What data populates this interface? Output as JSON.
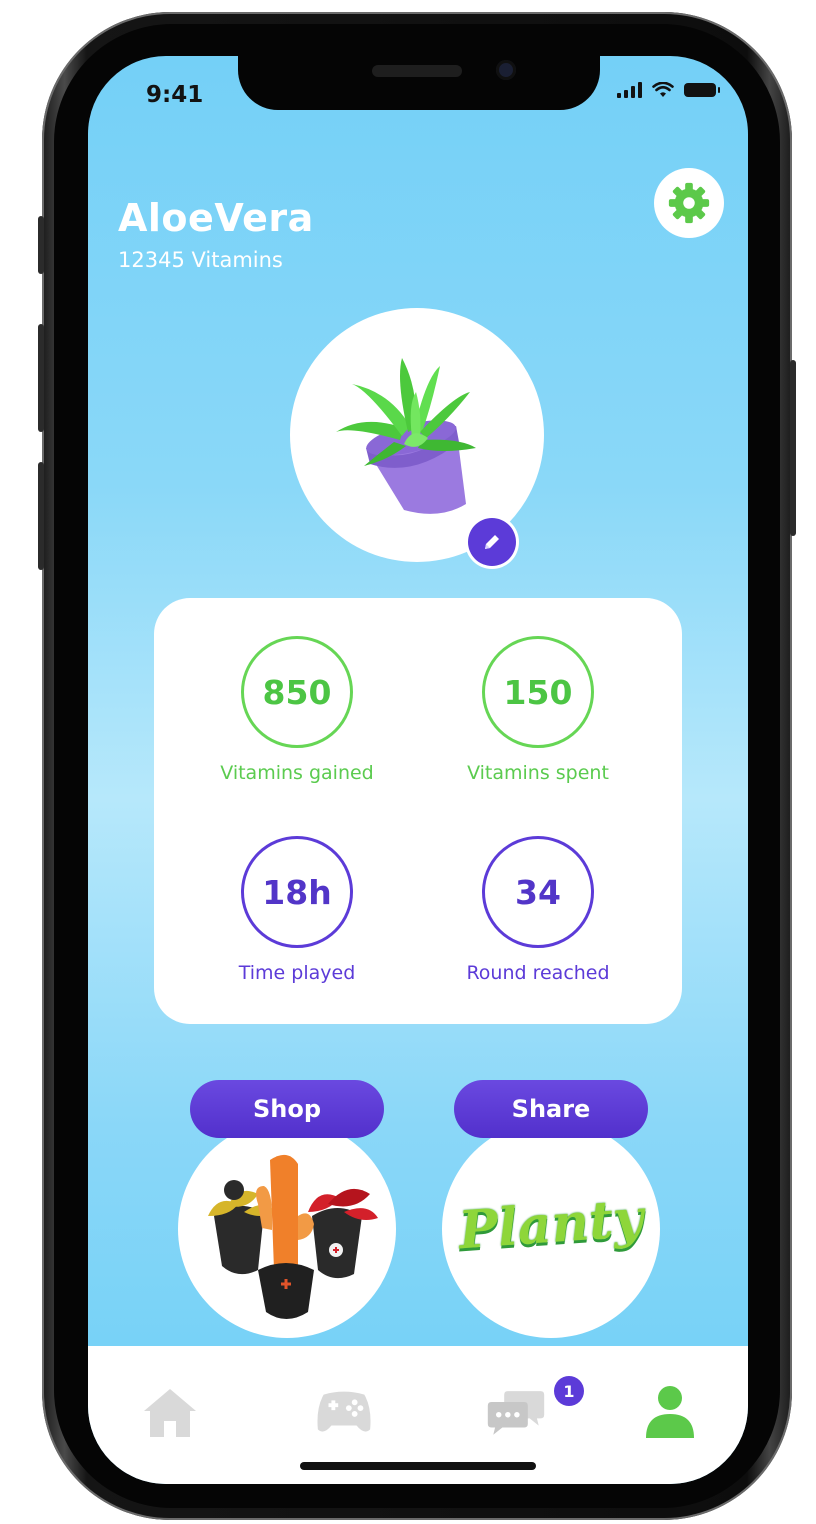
{
  "status_bar": {
    "time": "9:41"
  },
  "profile": {
    "name": "AloeVera",
    "vitamins": "12345 Vitamins"
  },
  "stats": [
    {
      "value": "850",
      "label": "Vitamins gained",
      "color": "#4cc544"
    },
    {
      "value": "150",
      "label": "Vitamins spent",
      "color": "#4cc544"
    },
    {
      "value": "18h",
      "label": "Time played",
      "color": "#5235c8"
    },
    {
      "value": "34",
      "label": "Round reached",
      "color": "#5235c8"
    }
  ],
  "actions": {
    "shop_label": "Shop",
    "share_label": "Share",
    "brand_text": "Planty"
  },
  "tabbar": {
    "items": [
      "home-icon",
      "gamepad-icon",
      "chat-icon",
      "profile-icon"
    ],
    "chat_badge": "1",
    "active": "profile-icon"
  },
  "colors": {
    "accent_purple": "#5c3bd8",
    "accent_green": "#4cc544",
    "sky_blue": "#74d0f7"
  }
}
